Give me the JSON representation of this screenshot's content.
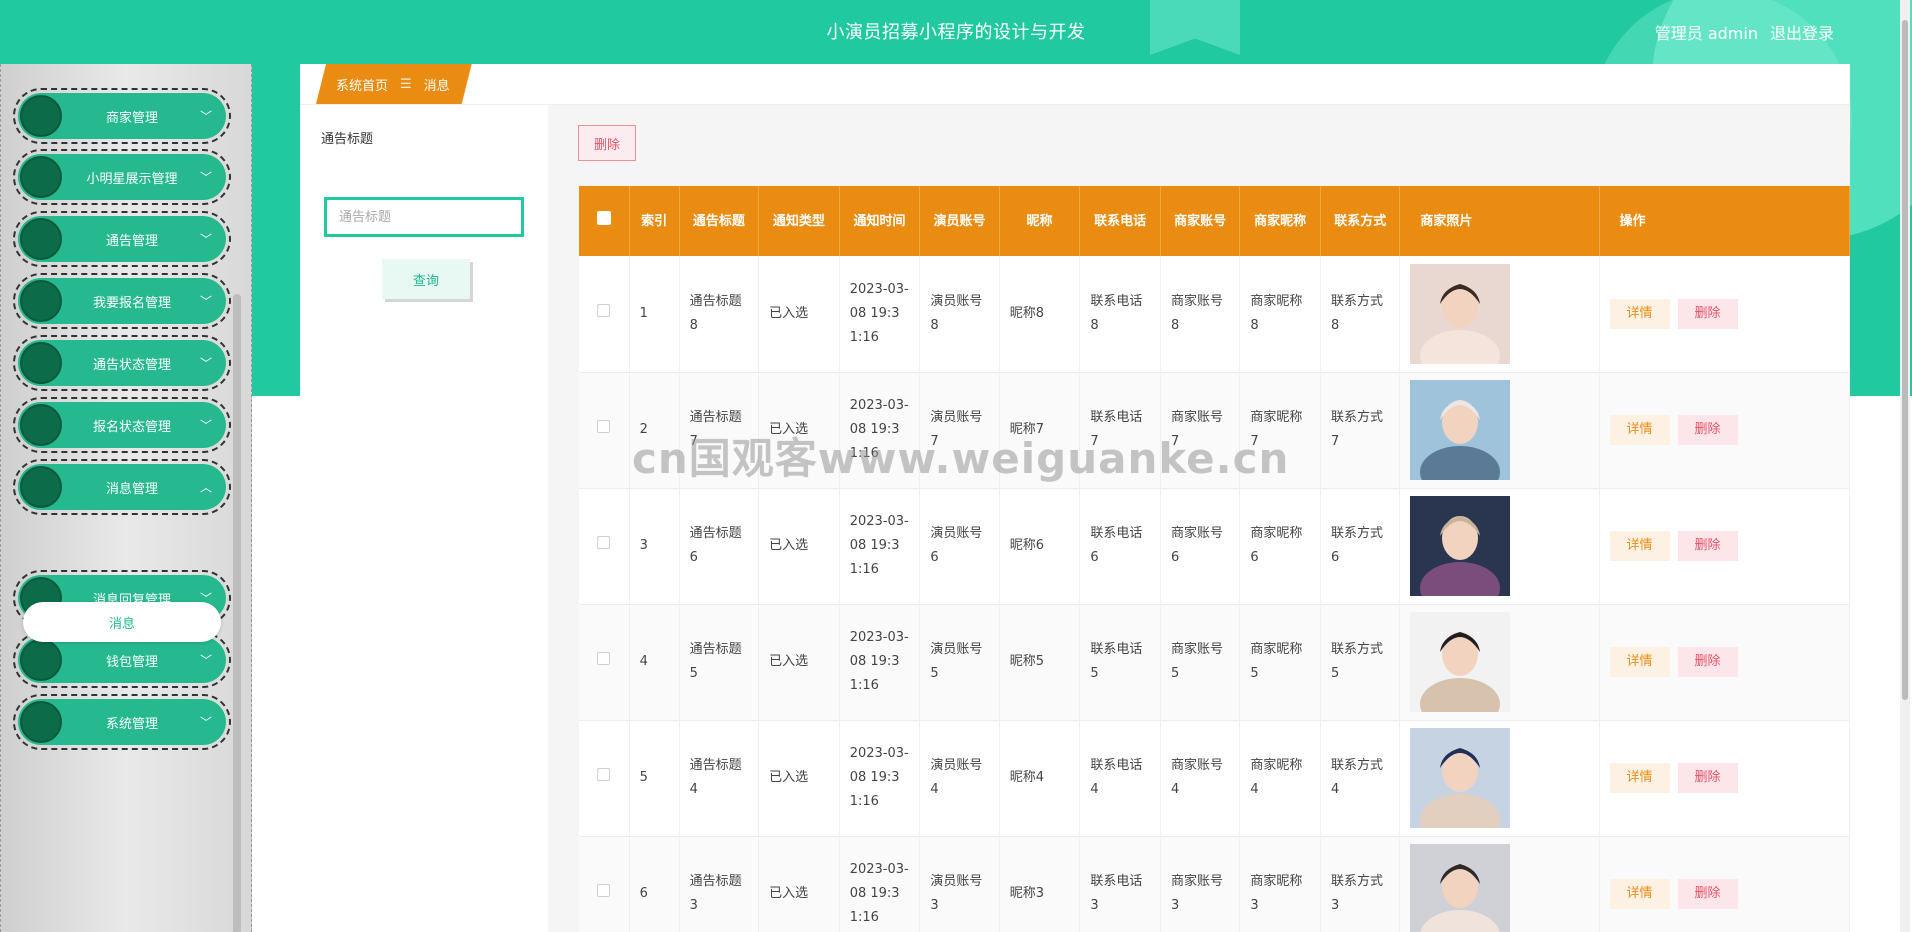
{
  "app": {
    "title": "小演员招募小程序的设计与开发",
    "user_label": "管理员 admin",
    "logout_label": "退出登录"
  },
  "sidebar": {
    "items": [
      {
        "label": "商家管理",
        "expanded": false
      },
      {
        "label": "小明星展示管理",
        "expanded": false
      },
      {
        "label": "通告管理",
        "expanded": false
      },
      {
        "label": "我要报名管理",
        "expanded": false
      },
      {
        "label": "通告状态管理",
        "expanded": false
      },
      {
        "label": "报名状态管理",
        "expanded": false
      },
      {
        "label": "消息管理",
        "expanded": true
      },
      {
        "label": "消息回复管理",
        "expanded": false
      },
      {
        "label": "钱包管理",
        "expanded": false
      },
      {
        "label": "系统管理",
        "expanded": false
      }
    ],
    "active_sub": "消息"
  },
  "breadcrumb": {
    "home": "系统首页",
    "sep": "☰",
    "current": "消息"
  },
  "filter": {
    "label": "通告标题",
    "placeholder": "通告标题",
    "query_label": "查询"
  },
  "actions": {
    "delete_label": "删除"
  },
  "table": {
    "headers": [
      "索引",
      "通告标题",
      "通知类型",
      "通知时间",
      "演员账号",
      "昵称",
      "联系电话",
      "商家账号",
      "商家昵称",
      "联系方式",
      "商家照片",
      "操作"
    ],
    "detail_label": "详情",
    "delete_label": "删除",
    "rows": [
      {
        "idx": "1",
        "title": "通告标题8",
        "type": "已入选",
        "time": "2023-03-08 19:31:16",
        "actor": "演员账号8",
        "nick": "昵称8",
        "phone": "联系电话8",
        "shop": "商家账号8",
        "shop_nick": "商家昵称8",
        "contact": "联系方式8"
      },
      {
        "idx": "2",
        "title": "通告标题7",
        "type": "已入选",
        "time": "2023-03-08 19:31:16",
        "actor": "演员账号7",
        "nick": "昵称7",
        "phone": "联系电话7",
        "shop": "商家账号7",
        "shop_nick": "商家昵称7",
        "contact": "联系方式7"
      },
      {
        "idx": "3",
        "title": "通告标题6",
        "type": "已入选",
        "time": "2023-03-08 19:31:16",
        "actor": "演员账号6",
        "nick": "昵称6",
        "phone": "联系电话6",
        "shop": "商家账号6",
        "shop_nick": "商家昵称6",
        "contact": "联系方式6"
      },
      {
        "idx": "4",
        "title": "通告标题5",
        "type": "已入选",
        "time": "2023-03-08 19:31:16",
        "actor": "演员账号5",
        "nick": "昵称5",
        "phone": "联系电话5",
        "shop": "商家账号5",
        "shop_nick": "商家昵称5",
        "contact": "联系方式5"
      },
      {
        "idx": "5",
        "title": "通告标题4",
        "type": "已入选",
        "time": "2023-03-08 19:31:16",
        "actor": "演员账号4",
        "nick": "昵称4",
        "phone": "联系电话4",
        "shop": "商家账号4",
        "shop_nick": "商家昵称4",
        "contact": "联系方式4"
      },
      {
        "idx": "6",
        "title": "通告标题3",
        "type": "已入选",
        "time": "2023-03-08 19:31:16",
        "actor": "演员账号3",
        "nick": "昵称3",
        "phone": "联系电话3",
        "shop": "商家账号3",
        "shop_nick": "商家昵称3",
        "contact": "联系方式3"
      }
    ]
  },
  "watermark": "cn国观客www.weiguanke.cn",
  "colors": {
    "brand_green": "#20c9a0",
    "header_orange": "#ea8c12",
    "danger": "#e25368"
  }
}
